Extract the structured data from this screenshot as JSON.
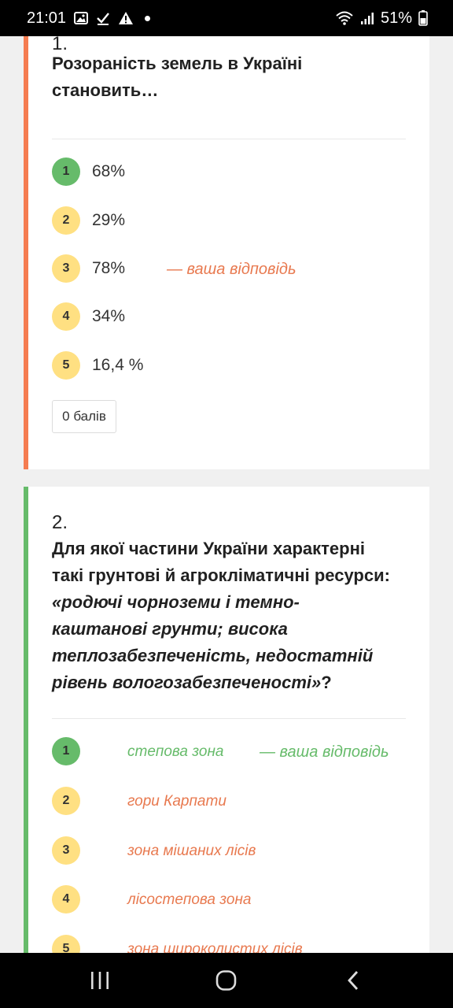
{
  "status_bar": {
    "time": "21:01",
    "battery": "51%",
    "icons": [
      "image-icon",
      "check-icon",
      "warning-icon",
      "dot-icon",
      "wifi-icon",
      "signal-icon",
      "battery-icon"
    ]
  },
  "questions": [
    {
      "number": "1.",
      "text": "Розораність земель в Україні становить…",
      "options": [
        {
          "index": "1",
          "text": "68%",
          "state": "correct"
        },
        {
          "index": "2",
          "text": "29%",
          "state": "normal"
        },
        {
          "index": "3",
          "text": "78%",
          "state": "selected-wrong",
          "note": "— ваша відповідь"
        },
        {
          "index": "4",
          "text": "34%",
          "state": "normal"
        },
        {
          "index": "5",
          "text": "16,4 %",
          "state": "normal"
        }
      ],
      "score": "0 балів"
    },
    {
      "number": "2.",
      "text_plain": "Для якої частини України характерні такі грунтові й агрокліматичні ресурси: ",
      "text_italic": "«родючі чорноземи і темно-каштанові грунти; висока теплозабезпеченість, недостатній рівень вологозабезпеченості»",
      "text_tail": "?",
      "options": [
        {
          "index": "1",
          "text": "степова зона",
          "state": "correct-selected",
          "note": "— ваша відповідь"
        },
        {
          "index": "2",
          "text": "гори Карпати",
          "state": "normal"
        },
        {
          "index": "3",
          "text": "зона мішаних лісів",
          "state": "normal"
        },
        {
          "index": "4",
          "text": "лісостепова зона",
          "state": "normal"
        },
        {
          "index": "5",
          "text": "зона широколистих лісів",
          "state": "normal"
        }
      ]
    }
  ],
  "colors": {
    "wrong_accent": "#f57c50",
    "correct_accent": "#66bb6a",
    "badge_default": "#ffe082"
  },
  "nav_bar": {
    "buttons": [
      "recent-apps-icon",
      "home-icon",
      "back-icon"
    ]
  }
}
